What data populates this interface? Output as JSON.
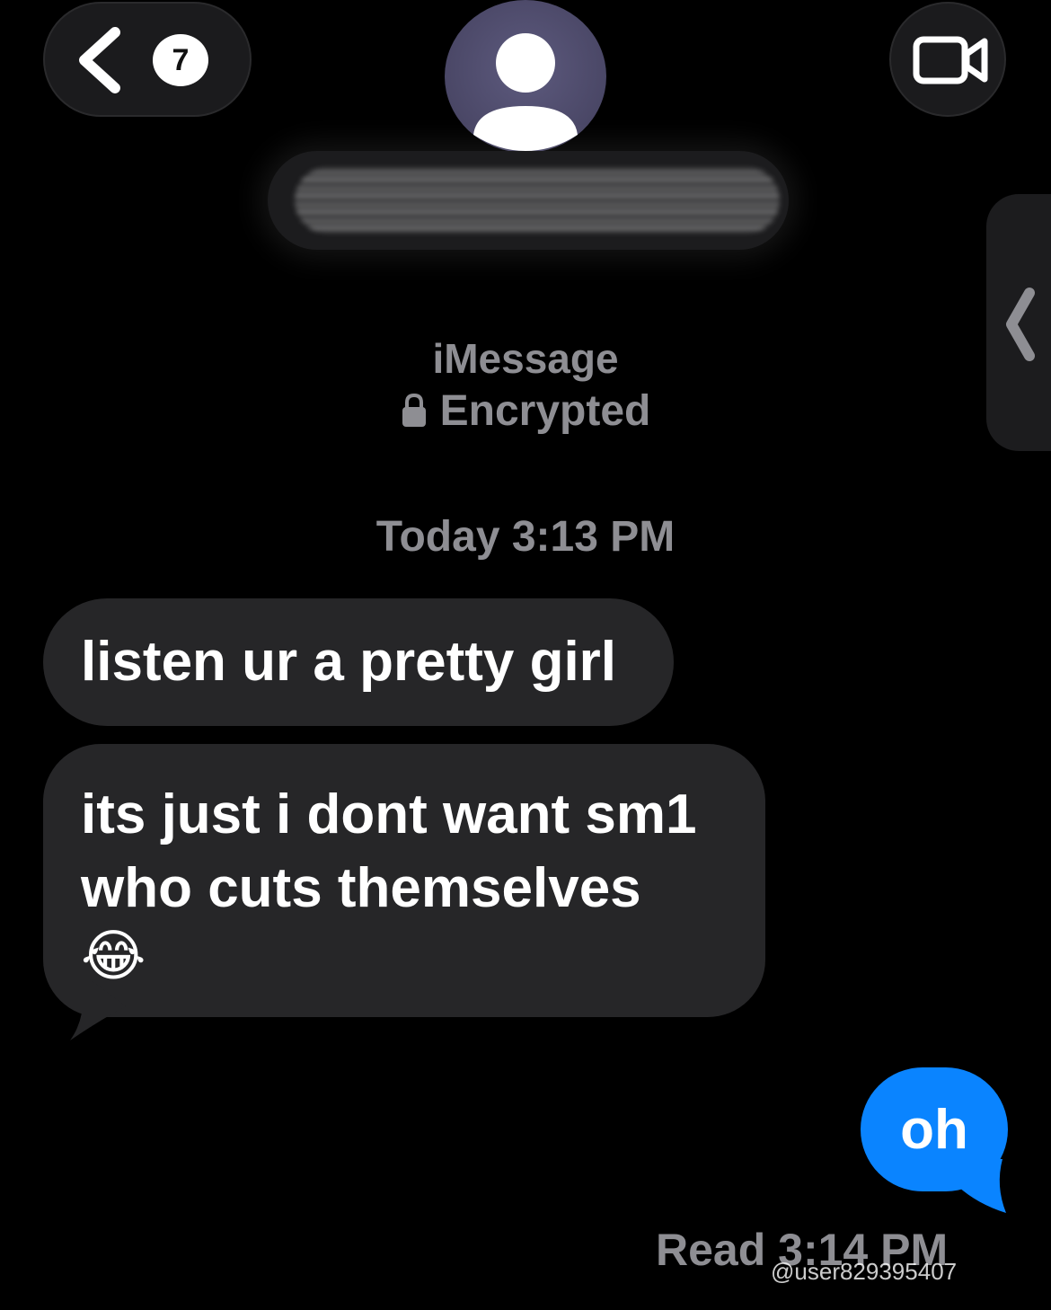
{
  "header": {
    "back_icon": "chevron-left-icon",
    "unread_count": "7",
    "avatar_icon": "person-icon",
    "video_icon": "video-camera-icon",
    "side_handle_icon": "chevron-left-icon"
  },
  "conversation": {
    "service": "iMessage",
    "encryption_label": "Encrypted",
    "lock_icon": "lock-icon",
    "timestamp_day": "Today",
    "timestamp_time": "3:13 PM"
  },
  "messages": [
    {
      "direction": "incoming",
      "text": "listen ur a pretty girl"
    },
    {
      "direction": "incoming",
      "text_line1": "its just i dont want sm1",
      "text_line2": "who cuts themselves",
      "emoji": "😂"
    },
    {
      "direction": "outgoing",
      "text": "oh"
    }
  ],
  "read_receipt": "Read 3:14 PM",
  "watermark": "@user829395407",
  "colors": {
    "background": "#000000",
    "incoming_bubble": "#262628",
    "outgoing_bubble": "#0a84ff",
    "secondary_text": "#8e8e93"
  }
}
